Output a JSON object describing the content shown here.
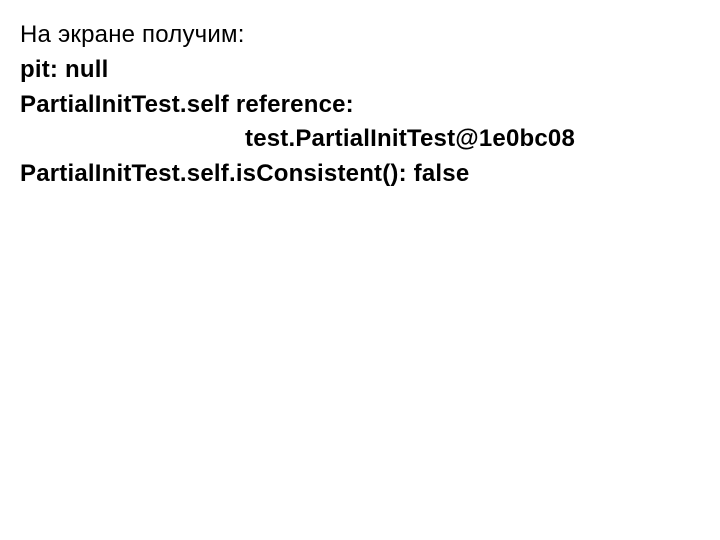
{
  "lines": {
    "intro": "На экране получим:",
    "l1": "pit: null",
    "l2": "PartialInitTest.self reference:",
    "l3": "test.PartialInitTest@1e0bc08",
    "l4": "PartialInitTest.self.isConsistent(): false"
  }
}
